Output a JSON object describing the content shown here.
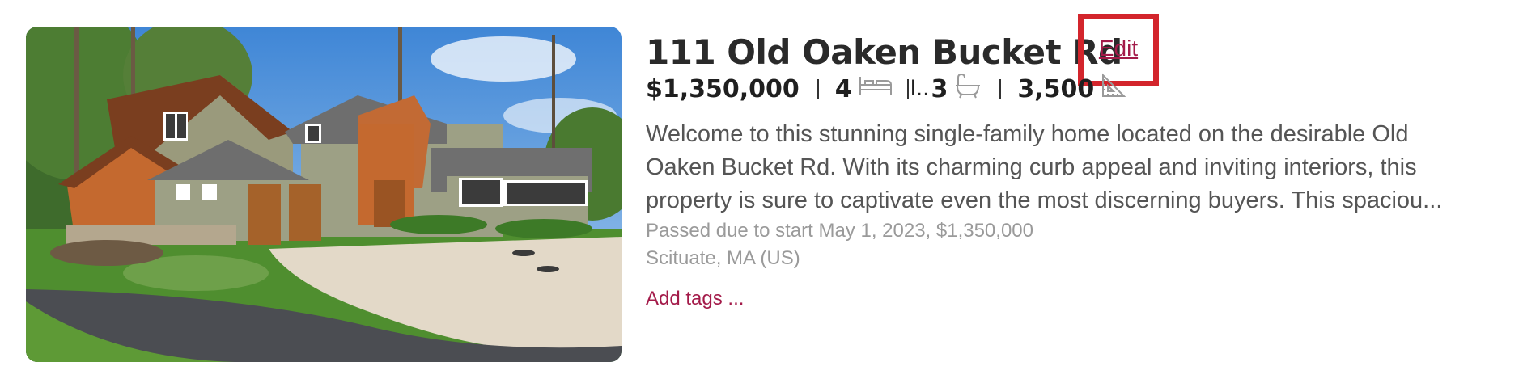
{
  "listing": {
    "address": "111 Old Oaken Bucket Rd",
    "edit_label": "Edit",
    "price": "$1,350,000",
    "beds": "4",
    "baths_prefix": "l..",
    "baths": "3",
    "sqft": "3,500",
    "icons": {
      "beds": "bed-icon",
      "baths": "bathtub-icon",
      "sqft": "ruler-triangle-icon"
    },
    "description_lines": [
      "Welcome to this stunning single-family home located on the desirable Old",
      "Oaken Bucket Rd. With its charming curb appeal and inviting interiors, this",
      "property is sure to captivate even the most discerning buyers. This spaciou..."
    ],
    "status": "Passed due to start May 1, 2023, $1,350,000",
    "location": "Scituate, MA (US)",
    "add_tags": "Add tags ..."
  },
  "colors": {
    "accent": "#a31a49",
    "highlight_box": "#d3252c",
    "muted_text": "#9a9a9a"
  }
}
